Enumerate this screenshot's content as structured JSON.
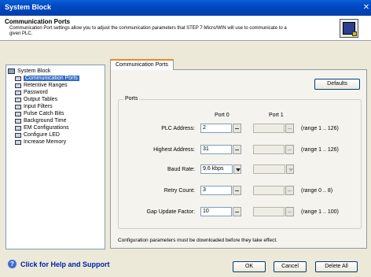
{
  "window": {
    "title": "System Block"
  },
  "header": {
    "title": "Communication Ports",
    "description": "Communication Port settings allow you to adjust the communication parameters that STEP 7-Micro/WIN will use to communicate to a given PLC."
  },
  "tree": {
    "root": "System Block",
    "items": [
      {
        "label": "Communication Ports",
        "selected": true
      },
      {
        "label": "Retentive Ranges"
      },
      {
        "label": "Password"
      },
      {
        "label": "Output Tables"
      },
      {
        "label": "Input Filters"
      },
      {
        "label": "Pulse Catch Bits"
      },
      {
        "label": "Background Time"
      },
      {
        "label": "EM Configurations"
      },
      {
        "label": "Configure LED"
      },
      {
        "label": "Increase Memory"
      }
    ]
  },
  "tab": {
    "label": "Communication Ports"
  },
  "defaults_button": "Defaults",
  "ports": {
    "group_label": "Ports",
    "port0_header": "Port 0",
    "port1_header": "Port 1",
    "rows": [
      {
        "label": "PLC Address:",
        "port0": "2",
        "port1": "",
        "range": "(range 1 .. 126)"
      },
      {
        "label": "Highest Address:",
        "port0": "31",
        "port1": "",
        "range": "(range 1 .. 126)"
      },
      {
        "label": "Baud Rate:",
        "port0": "9.6 kbps",
        "port1": "",
        "range": ""
      },
      {
        "label": "Retry Count:",
        "port0": "3",
        "port1": "",
        "range": "(range 0 .. 8)"
      },
      {
        "label": "Gap Update Factor:",
        "port0": "10",
        "port1": "",
        "range": "(range 1 .. 100)"
      }
    ]
  },
  "note": "Configuration parameters must be downloaded before they take effect.",
  "footer": {
    "help_link": "Click for Help and Support",
    "ok": "OK",
    "cancel": "Cancel",
    "delete_all": "Delete All"
  }
}
